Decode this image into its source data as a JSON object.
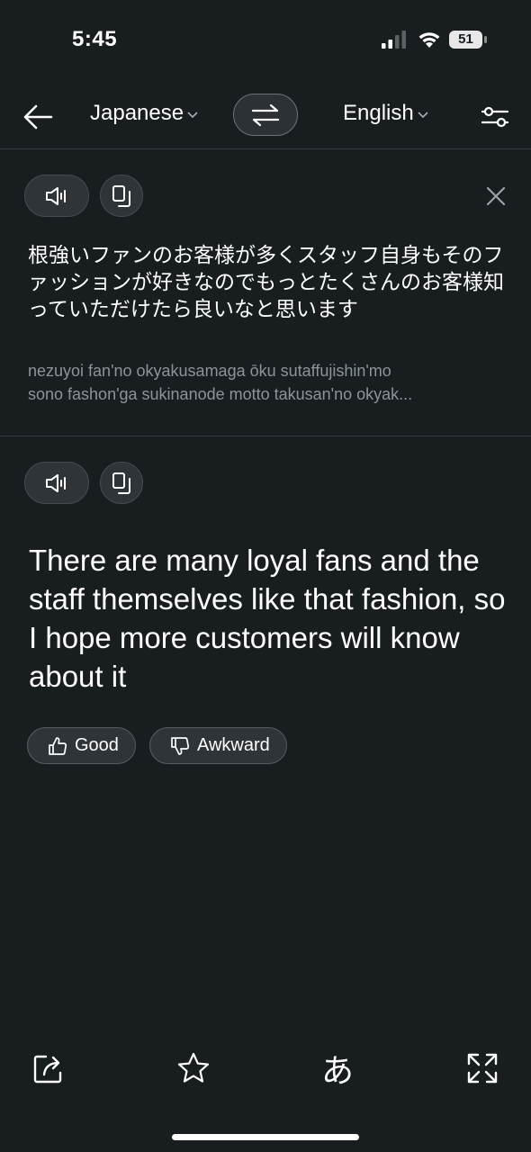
{
  "status_bar": {
    "time": "5:45",
    "battery_level": "51"
  },
  "toolbar": {
    "source_language": "Japanese",
    "target_language": "English",
    "icons": [
      "back-arrow-icon",
      "chevron-down-icon",
      "swap-icon",
      "settings-sliders-icon"
    ]
  },
  "source": {
    "text": "根強いファンのお客様が多くスタッフ自身もそのファッションが好きなのでもっとたくさんのお客様知っていただけたら良いなと思います",
    "romaji_line1": "nezuyoi fan'no okyakusamaga ōku sutaffujishin'mo",
    "romaji_line2": "sono fashon'ga sukinanode motto takusan'no okyak...",
    "icons": [
      "speaker-icon",
      "copy-icon",
      "close-icon"
    ]
  },
  "target": {
    "text": "There are many loyal fans and the staff themselves like that fashion, so I hope more customers will know about it",
    "icons": [
      "speaker-icon",
      "copy-icon"
    ]
  },
  "feedback": {
    "good_label": "Good",
    "awkward_label": "Awkward"
  },
  "bottom_bar": {
    "kana_label": "あ",
    "icons": [
      "share-icon",
      "star-icon",
      "kana-keyboard-icon",
      "expand-icon"
    ]
  },
  "colors": {
    "background": "#181d20",
    "pill_background": "#2e3438",
    "secondary_text": "#8d9498",
    "divider": "#353b3f"
  }
}
